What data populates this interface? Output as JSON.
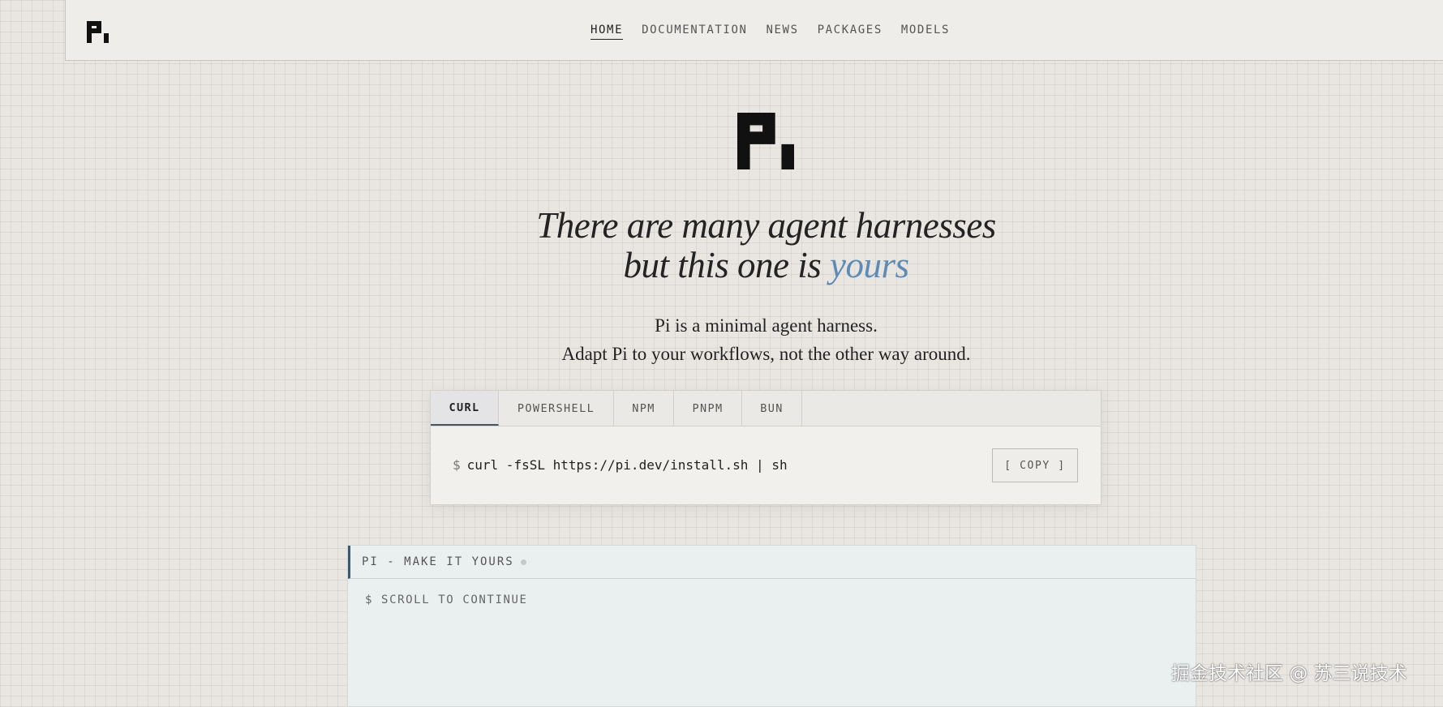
{
  "nav": {
    "items": [
      {
        "label": "HOME",
        "active": true
      },
      {
        "label": "DOCUMENTATION",
        "active": false
      },
      {
        "label": "NEWS",
        "active": false
      },
      {
        "label": "PACKAGES",
        "active": false
      },
      {
        "label": "MODELS",
        "active": false
      }
    ]
  },
  "hero": {
    "headline_line1": "There are many agent harnesses",
    "headline_line2_prefix": "but this one is ",
    "headline_line2_accent": "yours",
    "accent_color": "#5e8bb6",
    "subtitle_line1": "Pi is a minimal agent harness.",
    "subtitle_line2": "Adapt Pi to your workflows, not the other way around."
  },
  "install": {
    "tabs": [
      {
        "label": "CURL",
        "active": true
      },
      {
        "label": "POWERSHELL",
        "active": false
      },
      {
        "label": "NPM",
        "active": false
      },
      {
        "label": "PNPM",
        "active": false
      },
      {
        "label": "BUN",
        "active": false
      }
    ],
    "prompt": "$",
    "command": "curl -fsSL https://pi.dev/install.sh | sh",
    "copy_label": "[ COPY ]"
  },
  "terminal": {
    "title": "PI - MAKE IT YOURS",
    "line": "$ SCROLL TO CONTINUE"
  },
  "watermark": "掘金技术社区 @ 苏三说技术"
}
